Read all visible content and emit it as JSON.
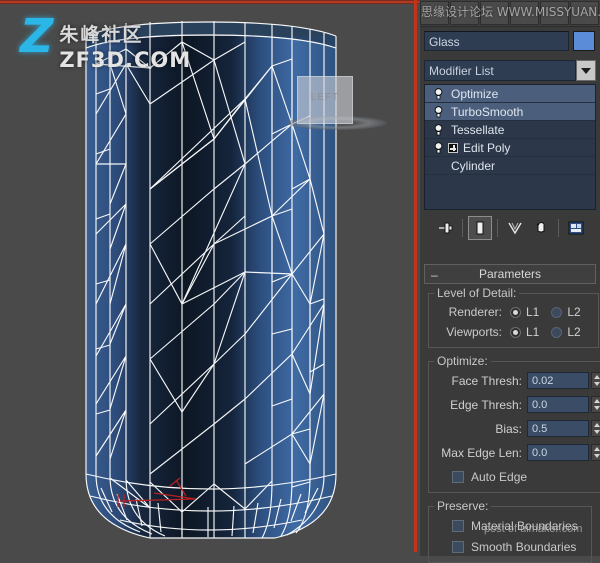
{
  "watermarks": {
    "zf_z": "Z",
    "zf_cn": "朱峰社区",
    "zf_en": "ZF3D.COM",
    "top_bar": "思缘设计论坛  WWW.MISSYUAN.COM",
    "bottom": "post of uimaker.com"
  },
  "viewport": {
    "label": "LEFT",
    "object": "triangulated-cylinder-mesh"
  },
  "command_panel": {
    "object_name": {
      "value": "Glass",
      "placeholder": "Glass"
    },
    "object_color": "#5a8cd8",
    "modifier_list": {
      "label": "Modifier List",
      "dropdown_icon": "chevron-down-icon"
    },
    "stack": [
      {
        "label": "Optimize",
        "icon": "lightbulb-icon",
        "selected": true,
        "expandable": false,
        "highlighted": true
      },
      {
        "label": "TurboSmooth",
        "icon": "lightbulb-icon",
        "selected": true,
        "expandable": false,
        "highlighted": true
      },
      {
        "label": "Tessellate",
        "icon": "lightbulb-icon",
        "selected": false,
        "expandable": false,
        "highlighted": false
      },
      {
        "label": "Edit Poly",
        "icon": "lightbulb-icon",
        "selected": false,
        "expandable": true,
        "highlighted": false
      },
      {
        "label": "Cylinder",
        "icon": "none",
        "selected": false,
        "expandable": false,
        "highlighted": false
      }
    ],
    "stack_tools": [
      {
        "name": "pin-stack-icon"
      },
      {
        "name": "show-end-result-icon",
        "active": true
      },
      {
        "name": "make-unique-icon"
      },
      {
        "name": "remove-modifier-icon"
      },
      {
        "name": "configure-modifier-sets-icon"
      }
    ],
    "rollout": {
      "collapse_glyph": "–",
      "title": "Parameters"
    },
    "level_of_detail": {
      "legend": "Level of Detail:",
      "rows": [
        {
          "label": "Renderer:",
          "options": [
            "L1",
            "L2"
          ],
          "selected": "L1"
        },
        {
          "label": "Viewports:",
          "options": [
            "L1",
            "L2"
          ],
          "selected": "L1"
        }
      ]
    },
    "optimize": {
      "legend": "Optimize:",
      "fields": [
        {
          "label": "Face Thresh:",
          "value": "0.02",
          "highlighted": true
        },
        {
          "label": "Edge Thresh:",
          "value": "0.0",
          "highlighted": true
        },
        {
          "label": "Bias:",
          "value": "0.5",
          "highlighted": true
        },
        {
          "label": "Max Edge Len:",
          "value": "0.0",
          "highlighted": false
        }
      ],
      "auto_edge": {
        "label": "Auto Edge",
        "checked": false
      }
    },
    "preserve": {
      "legend": "Preserve:",
      "checkboxes": [
        {
          "label": "Material Boundaries",
          "checked": false
        },
        {
          "label": "Smooth Boundaries",
          "checked": false
        }
      ]
    }
  },
  "colors": {
    "highlight": "#e02b10",
    "panel_bg": "#3a3a3a",
    "viewport_bg": "#4a4a4a",
    "field_bg": "#3b4d66",
    "accent_blue": "#2bb6e8"
  }
}
